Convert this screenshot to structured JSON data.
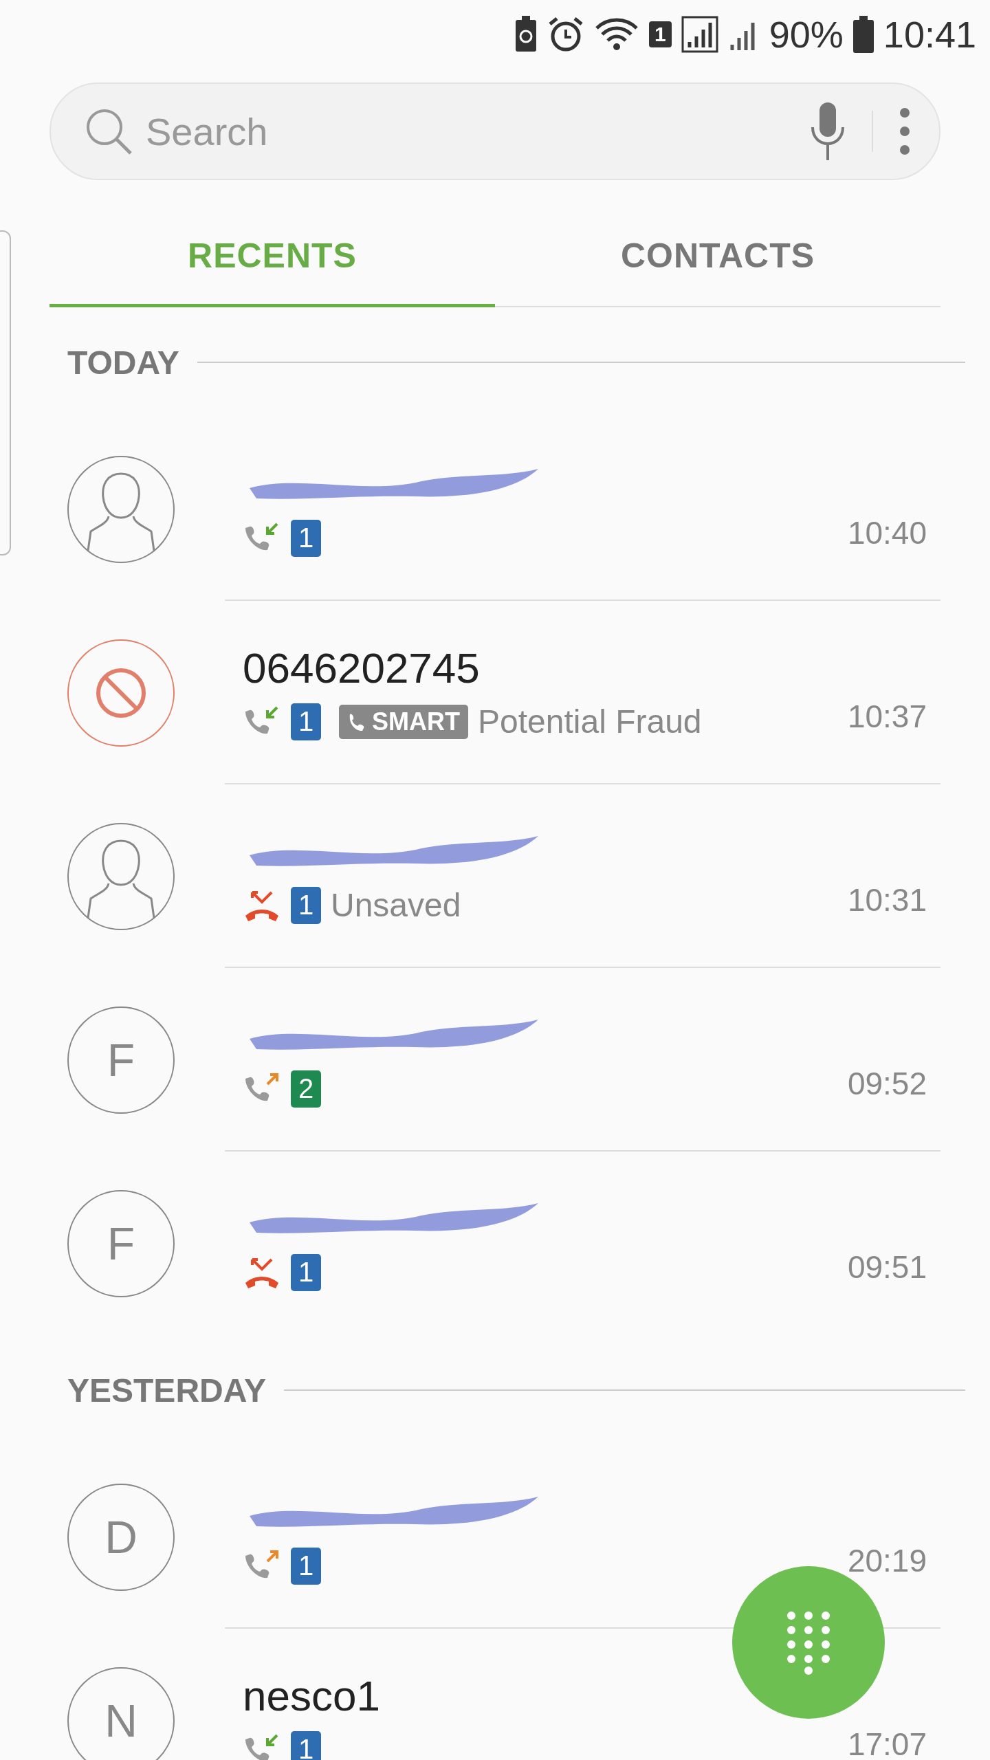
{
  "status_bar": {
    "battery_text": "90%",
    "time": "10:41",
    "sim_badge": "1"
  },
  "search": {
    "placeholder": "Search"
  },
  "tabs": [
    {
      "label": "RECENTS",
      "selected": true
    },
    {
      "label": "CONTACTS",
      "selected": false
    }
  ],
  "sections": [
    {
      "title": "TODAY",
      "calls": [
        {
          "avatar": {
            "kind": "person"
          },
          "redacted": true,
          "kind": "incoming",
          "sim": {
            "label": "1",
            "color": "#2f6db3"
          },
          "time": "10:40"
        },
        {
          "avatar": {
            "kind": "blocked"
          },
          "name": "0646202745",
          "kind": "incoming",
          "sim": {
            "label": "1",
            "color": "#2f6db3"
          },
          "badge": "SMART",
          "detail": "Potential Fraud",
          "time": "10:37"
        },
        {
          "avatar": {
            "kind": "person"
          },
          "redacted": true,
          "kind": "missed",
          "sim": {
            "label": "1",
            "color": "#2f6db3"
          },
          "detail": "Unsaved",
          "time": "10:31"
        },
        {
          "avatar": {
            "kind": "letter",
            "letter": "F"
          },
          "redacted": true,
          "kind": "outgoing",
          "sim": {
            "label": "2",
            "color": "#1e8a4f"
          },
          "time": "09:52"
        },
        {
          "avatar": {
            "kind": "letter",
            "letter": "F"
          },
          "redacted": true,
          "kind": "missed",
          "sim": {
            "label": "1",
            "color": "#2f6db3"
          },
          "time": "09:51"
        }
      ]
    },
    {
      "title": "YESTERDAY",
      "calls": [
        {
          "avatar": {
            "kind": "letter",
            "letter": "D"
          },
          "redacted": true,
          "kind": "outgoing",
          "sim": {
            "label": "1",
            "color": "#2f6db3"
          },
          "time": "20:19"
        },
        {
          "avatar": {
            "kind": "letter",
            "letter": "N"
          },
          "name": "nesco1",
          "kind": "incoming",
          "sim": {
            "label": "1",
            "color": "#2f6db3"
          },
          "time": "17:07"
        }
      ]
    }
  ]
}
